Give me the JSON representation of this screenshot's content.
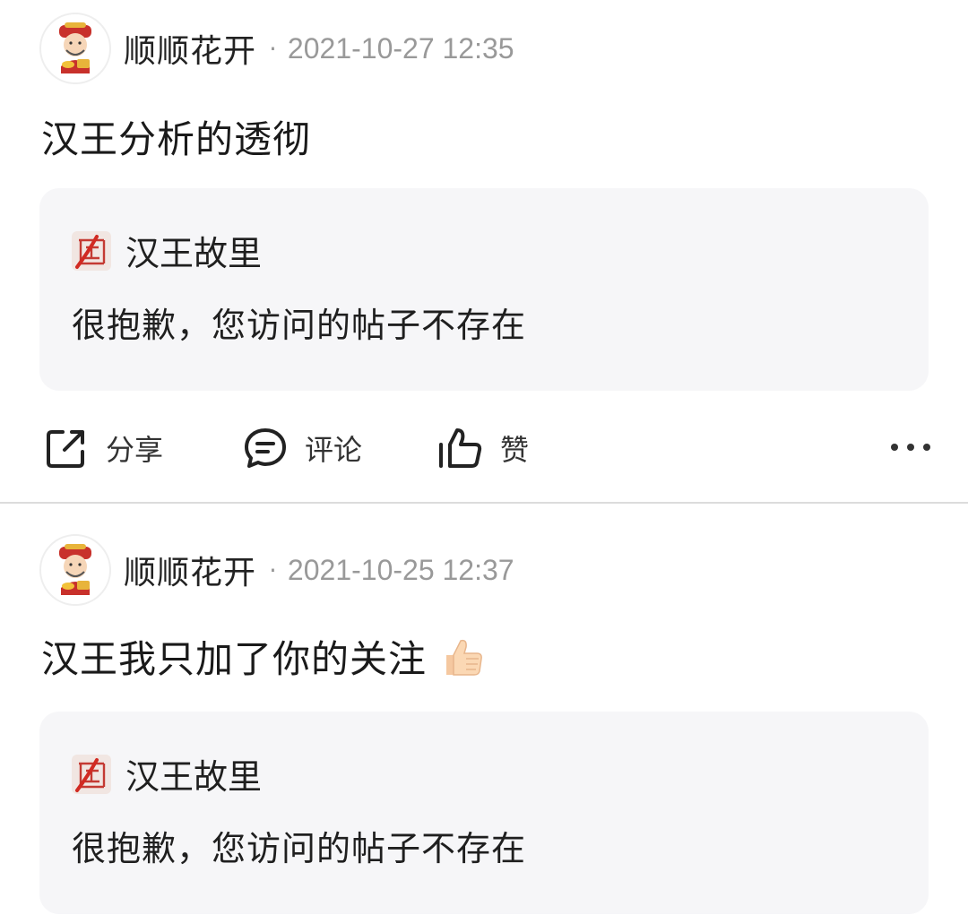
{
  "posts": [
    {
      "author": "顺顺花开",
      "separator": "·",
      "timestamp": "2021-10-27 12:35",
      "content": "汉王分析的透彻",
      "emoji": "",
      "quote": {
        "source_name": "汉王故里",
        "text": "很抱歉，您访问的帖子不存在"
      },
      "actions": {
        "share_label": "分享",
        "comment_label": "评论",
        "like_label": "赞"
      }
    },
    {
      "author": "顺顺花开",
      "separator": "·",
      "timestamp": "2021-10-25 12:37",
      "content": "汉王我只加了你的关注",
      "emoji": "thumbs-up",
      "quote": {
        "source_name": "汉王故里",
        "text": "很抱歉，您访问的帖子不存在"
      }
    }
  ],
  "icons": {
    "share": "share-icon",
    "comment": "comment-icon",
    "like": "like-icon",
    "more": "more-icon",
    "avatar": "caishen-avatar",
    "source_logo": "hanwang-logo"
  },
  "colors": {
    "background": "#ffffff",
    "quote_background": "#f6f6f8",
    "timestamp": "#999999",
    "divider": "#dcdcdc"
  }
}
